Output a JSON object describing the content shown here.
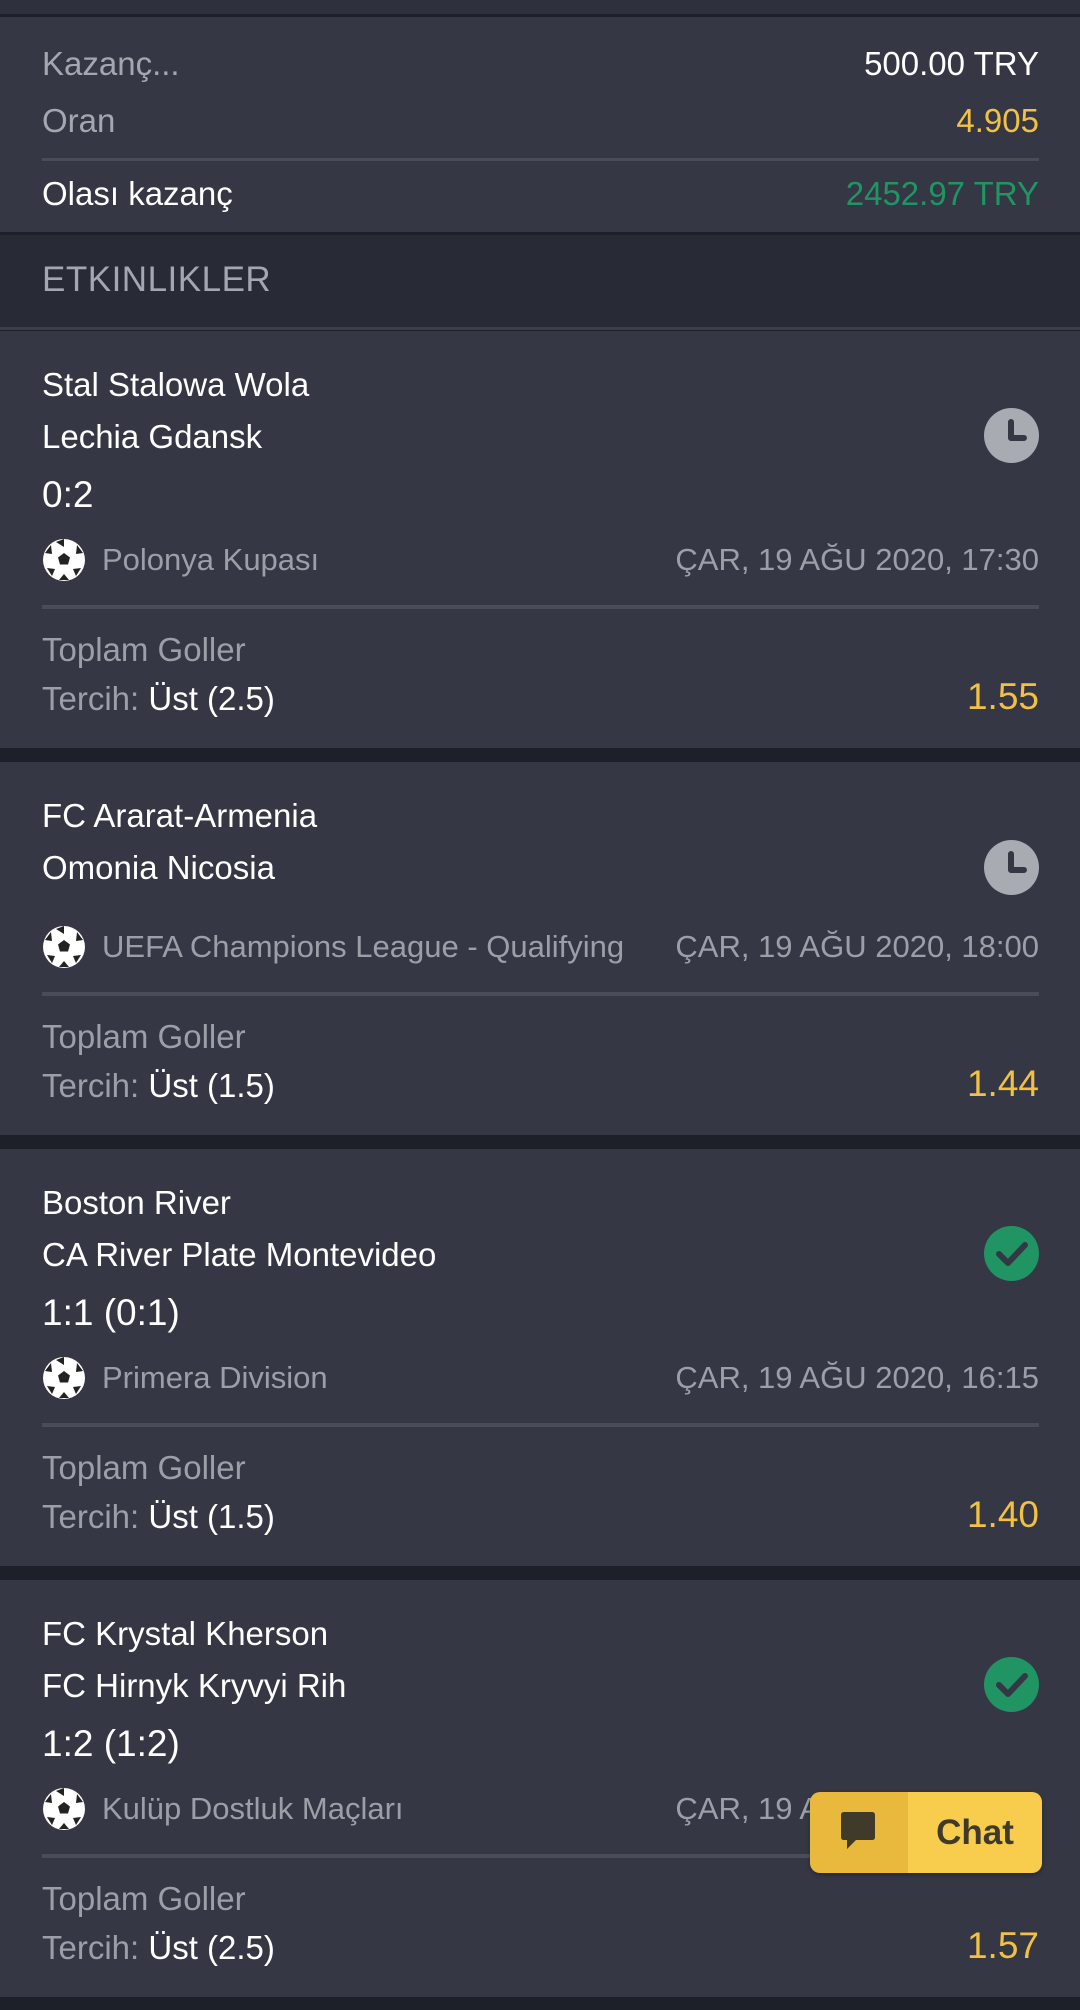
{
  "summary": {
    "stake_label": "Kazanç...",
    "stake_value": "500.00 TRY",
    "odds_label": "Oran",
    "odds_value": "4.905",
    "potential_label": "Olası kazanç",
    "potential_value": "2452.97 TRY"
  },
  "colors": {
    "odds": "#f2c144",
    "potential": "#219464",
    "check": "#219464",
    "chat": "#f8cd4e"
  },
  "events_header": "ETKINLIKLER",
  "events": [
    {
      "team1": "Stal Stalowa Wola",
      "team2": "Lechia Gdansk",
      "score": "0:2",
      "status_icon": "clock-icon",
      "league": "Polonya Kupası",
      "date": "ÇAR, 19 AĞU 2020, 17:30",
      "market": "Toplam Goller",
      "pick_label": "Tercih:",
      "pick_value": "Üst (2.5)",
      "odd": "1.55"
    },
    {
      "team1": "FC Ararat-Armenia",
      "team2": "Omonia Nicosia",
      "score": "",
      "status_icon": "clock-icon",
      "league": "UEFA Champions League - Qualifying",
      "date": "ÇAR, 19 AĞU 2020, 18:00",
      "market": "Toplam Goller",
      "pick_label": "Tercih:",
      "pick_value": "Üst (1.5)",
      "odd": "1.44"
    },
    {
      "team1": "Boston River",
      "team2": "CA River Plate Montevideo",
      "score": "1:1 (0:1)",
      "status_icon": "check-icon",
      "league": "Primera Division",
      "date": "ÇAR, 19 AĞU 2020, 16:15",
      "market": "Toplam Goller",
      "pick_label": "Tercih:",
      "pick_value": "Üst (1.5)",
      "odd": "1.40"
    },
    {
      "team1": "FC Krystal Kherson",
      "team2": "FC Hirnyk Kryvyi Rih",
      "score": "1:2 (1:2)",
      "status_icon": "check-icon",
      "league": "Kulüp Dostluk Maçları",
      "date": "ÇAR, 19 AĞU 2020, 14:00",
      "market": "Toplam Goller",
      "pick_label": "Tercih:",
      "pick_value": "Üst (2.5)",
      "odd": "1.57"
    }
  ],
  "chat": {
    "label": "Chat",
    "icon": "chat-bubble-icon"
  }
}
